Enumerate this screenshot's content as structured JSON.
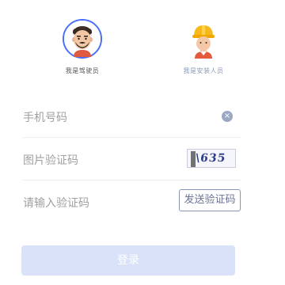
{
  "roles": {
    "driver": {
      "label": "我是驾驶员"
    },
    "installer": {
      "label": "我是安装人员"
    }
  },
  "form": {
    "phone_placeholder": "手机号码",
    "captcha_placeholder": "图片验证码",
    "captcha_text": "\\635",
    "code_placeholder": "请输入验证码",
    "send_code_label": "发送验证码",
    "clear_symbol": "×"
  },
  "login_label": "登录",
  "colors": {
    "accent": "#4a6ef5",
    "login_bg": "#d9e2f9"
  }
}
